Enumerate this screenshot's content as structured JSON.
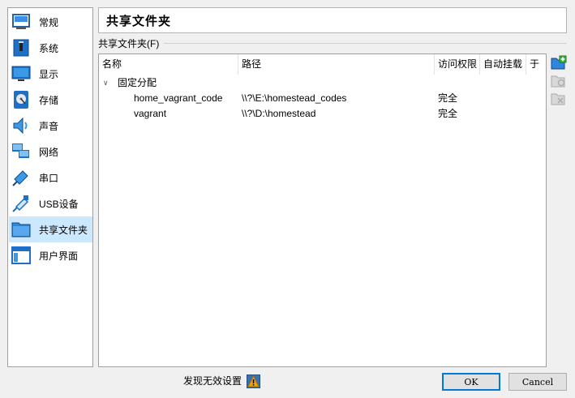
{
  "sidebar": {
    "items": [
      {
        "label": "常规",
        "icon": "general-icon"
      },
      {
        "label": "系统",
        "icon": "system-icon"
      },
      {
        "label": "显示",
        "icon": "display-icon"
      },
      {
        "label": "存储",
        "icon": "storage-icon"
      },
      {
        "label": "声音",
        "icon": "audio-icon"
      },
      {
        "label": "网络",
        "icon": "network-icon"
      },
      {
        "label": "串口",
        "icon": "serial-port-icon"
      },
      {
        "label": "USB设备",
        "icon": "usb-icon"
      },
      {
        "label": "共享文件夹",
        "icon": "shared-folder-icon",
        "selected": true
      },
      {
        "label": "用户界面",
        "icon": "user-interface-icon"
      }
    ]
  },
  "header": {
    "title": "共享文件夹"
  },
  "group": {
    "title": "共享文件夹(F)"
  },
  "table": {
    "columns": [
      "名称",
      "路径",
      "访问权限",
      "自动挂载",
      "于"
    ],
    "group_label": "固定分配",
    "rows": [
      {
        "name": "home_vagrant_code",
        "path": "\\\\?\\E:\\homestead_codes",
        "access": "完全"
      },
      {
        "name": "vagrant",
        "path": "\\\\?\\D:\\homestead",
        "access": "完全"
      }
    ]
  },
  "toolbar": {
    "icons": [
      "add-shared-folder-icon",
      "edit-shared-folder-icon",
      "remove-shared-folder-icon"
    ]
  },
  "footer": {
    "warning_label": "发现无效设置",
    "ok_label": "OK",
    "cancel_label": "Cancel"
  },
  "colors": {
    "selection": "#cce8ff",
    "accent": "#0078d7",
    "warning": "#f0a30a"
  }
}
